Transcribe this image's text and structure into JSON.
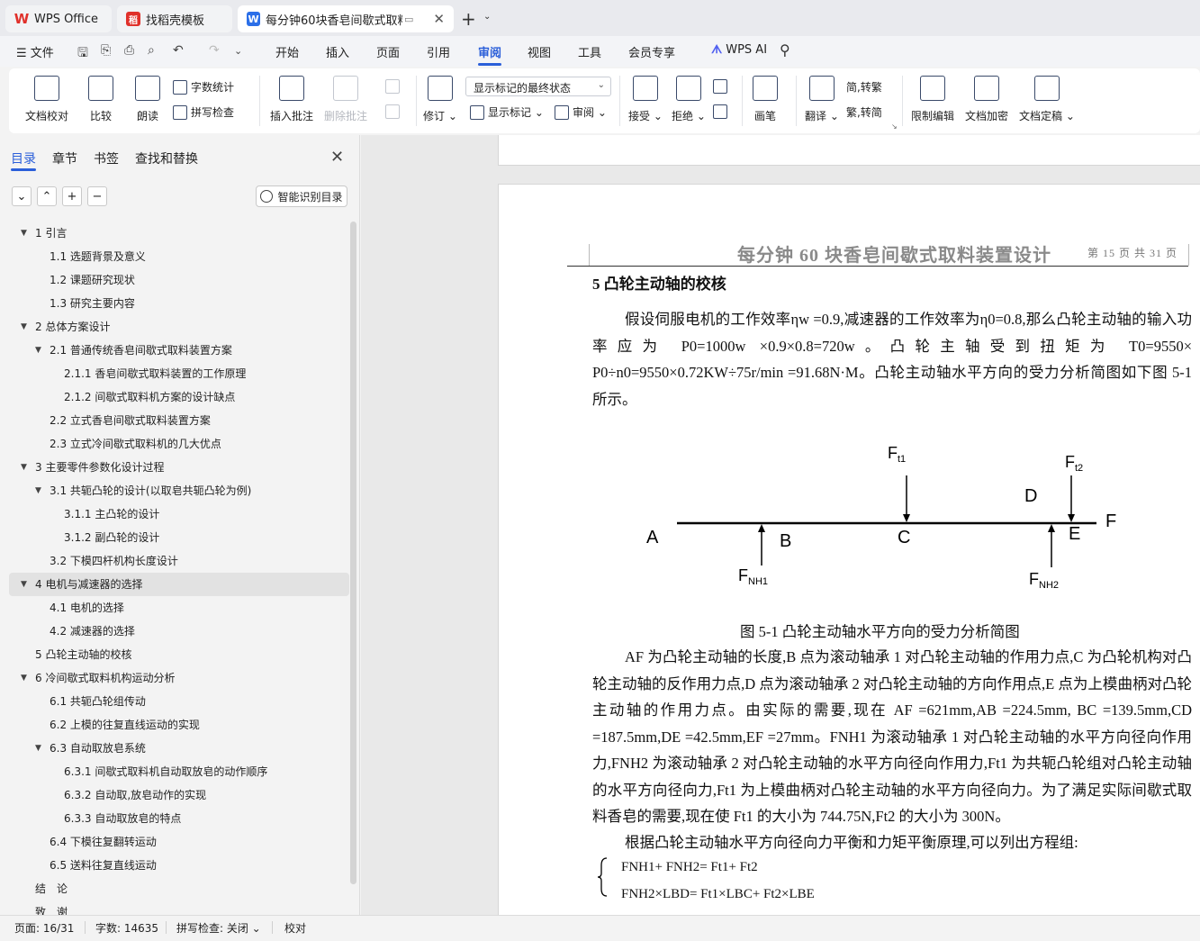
{
  "tabs": {
    "wps_label": "WPS Office",
    "template_label": "找稻壳模板",
    "doc_title": "每分钟60块香皂间歇式取料装"
  },
  "menu": {
    "file": "文件",
    "items": [
      "开始",
      "插入",
      "页面",
      "引用",
      "审阅",
      "视图",
      "工具",
      "会员专享"
    ],
    "active": "审阅",
    "ai": "WPS AI"
  },
  "ribbon": {
    "doc_check": "文档校对",
    "compare": "比较",
    "read_aloud": "朗读",
    "word_count": "字数统计",
    "spell_check": "拼写检查",
    "insert_comment": "插入批注",
    "delete_comment": "删除批注",
    "revise": "修订",
    "markup_state": "显示标记的最终状态",
    "show_markup": "显示标记",
    "review": "审阅",
    "accept": "接受",
    "reject": "拒绝",
    "pen": "画笔",
    "translate": "翻译",
    "to_traditional": "简,转繁",
    "to_simplified": "繁,转简",
    "restrict_edit": "限制编辑",
    "encrypt": "文档加密",
    "finalize": "文档定稿"
  },
  "sidebar": {
    "tabs": [
      "目录",
      "章节",
      "书签",
      "查找和替换"
    ],
    "smart_toc": "智能识别目录",
    "toc": [
      {
        "label": "1 引言",
        "level": 1,
        "arrow": true
      },
      {
        "label": "1.1 选题背景及意义",
        "level": 2
      },
      {
        "label": "1.2 课题研究现状",
        "level": 2
      },
      {
        "label": "1.3 研究主要内容",
        "level": 2
      },
      {
        "label": "2 总体方案设计",
        "level": 1,
        "arrow": true
      },
      {
        "label": "2.1 普通传统香皂间歇式取料装置方案",
        "level": 2,
        "arrow": true
      },
      {
        "label": "2.1.1 香皂间歇式取料装置的工作原理",
        "level": 3
      },
      {
        "label": "2.1.2 间歇式取料机方案的设计缺点",
        "level": 3
      },
      {
        "label": "2.2 立式香皂间歇式取料装置方案",
        "level": 2
      },
      {
        "label": "2.3 立式冷间歇式取料机的几大优点",
        "level": 2
      },
      {
        "label": "3 主要零件参数化设计过程",
        "level": 1,
        "arrow": true
      },
      {
        "label": "3.1 共轭凸轮的设计(以取皂共轭凸轮为例)",
        "level": 2,
        "arrow": true
      },
      {
        "label": "3.1.1 主凸轮的设计",
        "level": 3
      },
      {
        "label": "3.1.2 副凸轮的设计",
        "level": 3
      },
      {
        "label": "3.2 下模四杆机构长度设计",
        "level": 2
      },
      {
        "label": "4 电机与减速器的选择",
        "level": 1,
        "arrow": true,
        "selected": true
      },
      {
        "label": "4.1 电机的选择",
        "level": 2
      },
      {
        "label": "4.2 减速器的选择",
        "level": 2
      },
      {
        "label": "5 凸轮主动轴的校核",
        "level": 1
      },
      {
        "label": "6 冷间歇式取料机构运动分析",
        "level": 1,
        "arrow": true
      },
      {
        "label": "6.1 共轭凸轮组传动",
        "level": 2
      },
      {
        "label": "6.2 上模的往复直线运动的实现",
        "level": 2
      },
      {
        "label": "6.3 自动取放皂系统",
        "level": 2,
        "arrow": true
      },
      {
        "label": "6.3.1 间歇式取料机自动取放皂的动作顺序",
        "level": 3
      },
      {
        "label": "6.3.2 自动取,放皂动作的实现",
        "level": 3
      },
      {
        "label": "6.3.3 自动取放皂的特点",
        "level": 3
      },
      {
        "label": "6.4 下模往复翻转运动",
        "level": 2
      },
      {
        "label": "6.5 送料往复直线运动",
        "level": 2
      },
      {
        "label": "结　论",
        "level": 1
      },
      {
        "label": "致　谢",
        "level": 1
      }
    ]
  },
  "document": {
    "header_title": "每分钟 60 块香皂间歇式取料装置设计",
    "header_page": "第 15 页 共 31 页",
    "section_title": "5 凸轮主动轴的校核",
    "para1": "假设伺服电机的工作效率ηw =0.9,减速器的工作效率为η0=0.8,那么凸轮主动轴的输入功率应为 P0=1000w ×0.9×0.8=720w。凸轮主轴受到扭矩为 T0=9550× P0÷n0=9550×0.72KW÷75r/min =91.68N·M。凸轮主动轴水平方向的受力分析简图如下图 5-1 所示。",
    "figure": {
      "point_labels": [
        "A",
        "B",
        "C",
        "D",
        "E",
        "F"
      ],
      "force_ft1": "F",
      "force_ft1_sub": "t1",
      "force_ft2": "F",
      "force_ft2_sub": "t2",
      "force_fnh1": "F",
      "force_fnh1_sub": "NH1",
      "force_fnh2": "F",
      "force_fnh2_sub": "NH2"
    },
    "figure_caption": "图 5-1  凸轮主动轴水平方向的受力分析简图",
    "para2": "AF 为凸轮主动轴的长度,B 点为滚动轴承 1 对凸轮主动轴的作用力点,C 为凸轮机构对凸轮主动轴的反作用力点,D 点为滚动轴承 2 对凸轮主动轴的方向作用点,E 点为上模曲柄对凸轮主动轴的作用力点。由实际的需要,现在 AF =621mm,AB =224.5mm, BC =139.5mm,CD =187.5mm,DE =42.5mm,EF =27mm。FNH1 为滚动轴承 1 对凸轮主动轴的水平方向径向作用力,FNH2 为滚动轴承 2 对凸轮主动轴的水平方向径向作用力,Ft1 为共轭凸轮组对凸轮主动轴的水平方向径向力,Ft1 为上模曲柄对凸轮主动轴的水平方向径向力。为了满足实际间歇式取料香皂的需要,现在使 Ft1 的大小为 744.75N,Ft2 的大小为 300N。",
    "para3": "根据凸轮主动轴水平方向径向力平衡和力矩平衡原理,可以列出方程组:",
    "eq1": "FNH1+ FNH2= Ft1+ Ft2",
    "eq2": "FNH2×LBD= Ft1×LBC+ Ft2×LBE"
  },
  "status": {
    "page": "页面: 16/31",
    "words": "字数: 14635",
    "spell": "拼写检查: 关闭",
    "proof": "校对"
  }
}
